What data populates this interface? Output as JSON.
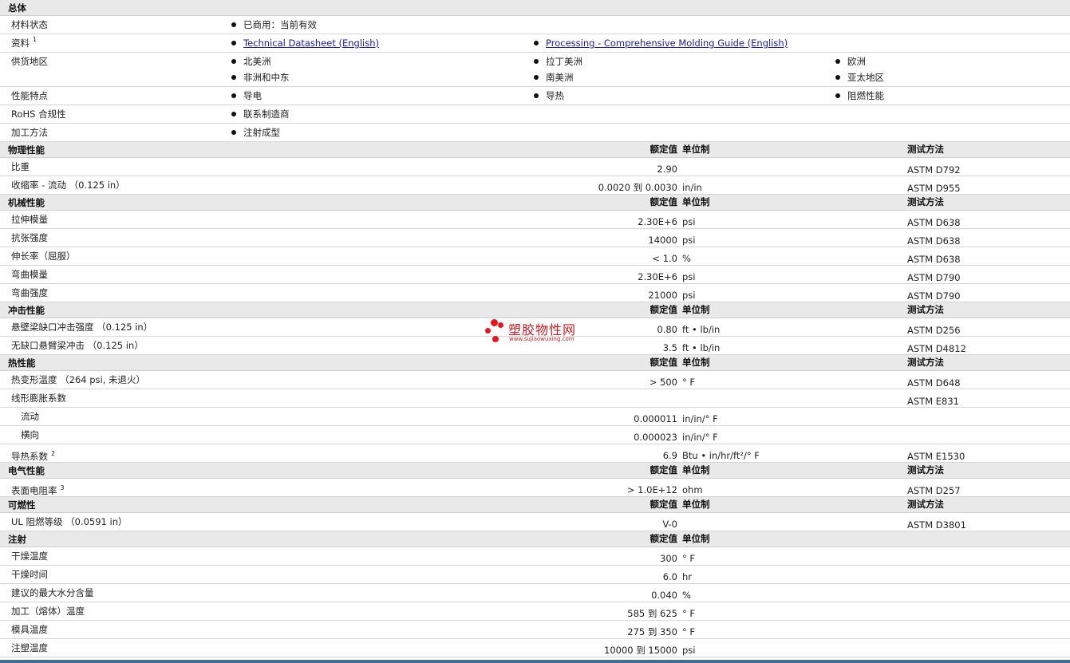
{
  "general": {
    "title": "总体",
    "rows": [
      {
        "label": "材料状态",
        "items": [
          "已商用：当前有效"
        ]
      },
      {
        "label": "资料",
        "sup": "1",
        "items": [
          "Technical Datasheet (English)",
          "Processing - Comprehensive Molding Guide (English)"
        ]
      },
      {
        "label": "供货地区",
        "items": [
          "北美洲",
          "拉丁美洲",
          "欧洲",
          "非洲和中东",
          "南美洲",
          "亚太地区"
        ]
      },
      {
        "label": "性能特点",
        "items": [
          "导电",
          "导热",
          "阻燃性能"
        ]
      },
      {
        "label": "RoHS 合规性",
        "items": [
          "联系制造商"
        ]
      },
      {
        "label": "加工方法",
        "items": [
          "注射成型"
        ]
      }
    ]
  },
  "col_headers": {
    "value": "额定值",
    "unit": "单位制",
    "test": "测试方法"
  },
  "sections": [
    {
      "title": "物理性能",
      "rows": [
        {
          "label": "比重",
          "value": "2.90",
          "unit": "",
          "test": "ASTM D792"
        },
        {
          "label": "收缩率 - 流动 （0.125 in）",
          "value": "0.0020 到  0.0030",
          "unit": "in/in",
          "test": "ASTM D955"
        }
      ]
    },
    {
      "title": "机械性能",
      "rows": [
        {
          "label": "拉伸模量",
          "value": "2.30E+6",
          "unit": "psi",
          "test": "ASTM D638"
        },
        {
          "label": "抗张强度",
          "value": "14000",
          "unit": "psi",
          "test": "ASTM D638"
        },
        {
          "label": "伸长率（屈服）",
          "value": "< 1.0",
          "unit": "%",
          "test": "ASTM D638"
        },
        {
          "label": "弯曲模量",
          "value": "2.30E+6",
          "unit": "psi",
          "test": "ASTM D790"
        },
        {
          "label": "弯曲强度",
          "value": "21000",
          "unit": "psi",
          "test": "ASTM D790"
        }
      ]
    },
    {
      "title": "冲击性能",
      "rows": [
        {
          "label": "悬壁梁缺口冲击强度 （0.125 in）",
          "value": "0.80",
          "unit": "ft • lb/in",
          "test": "ASTM D256"
        },
        {
          "label": "无缺口悬臂梁冲击 （0.125 in）",
          "value": "3.5",
          "unit": "ft • lb/in",
          "test": "ASTM D4812"
        }
      ]
    },
    {
      "title": "热性能",
      "rows": [
        {
          "label": "热变形温度 （264 psi, 未退火）",
          "value": "> 500",
          "unit": "°  F",
          "test": "ASTM D648"
        },
        {
          "label": "线形膨胀系数",
          "value": "",
          "unit": "",
          "test": "ASTM E831"
        },
        {
          "label": "流动",
          "sub": true,
          "value": "0.000011",
          "unit": "in/in/°  F",
          "test": ""
        },
        {
          "label": "横向",
          "sub": true,
          "value": "0.000023",
          "unit": "in/in/°  F",
          "test": ""
        },
        {
          "label": "导热系数",
          "sup": "2",
          "value": "6.9",
          "unit": "Btu • in/hr/ft²/°  F",
          "test": "ASTM E1530"
        }
      ]
    },
    {
      "title": "电气性能",
      "rows": [
        {
          "label": "表面电阻率",
          "sup": "3",
          "value": "> 1.0E+12",
          "unit": "ohm",
          "test": "ASTM D257"
        }
      ]
    },
    {
      "title": "可燃性",
      "rows": [
        {
          "label": "UL 阻燃等级 （0.0591 in）",
          "value": "V-0",
          "unit": "",
          "test": "ASTM D3801"
        }
      ]
    },
    {
      "title": "注射",
      "no_test": true,
      "rows": [
        {
          "label": "干燥温度",
          "value": "300",
          "unit": "°  F",
          "test": ""
        },
        {
          "label": "干燥时间",
          "value": "6.0",
          "unit": "hr",
          "test": ""
        },
        {
          "label": "建议的最大水分含量",
          "value": "0.040",
          "unit": "%",
          "test": ""
        },
        {
          "label": "加工（熔体）温度",
          "value": "585 到  625",
          "unit": "°  F",
          "test": ""
        },
        {
          "label": "模具温度",
          "value": "275 到  350",
          "unit": "°  F",
          "test": ""
        },
        {
          "label": "注塑温度",
          "value": "10000 到  15000",
          "unit": "psi",
          "test": ""
        }
      ]
    }
  ],
  "watermark": {
    "text": "塑胶物性网",
    "url": "www.sujiaowuxing.com"
  }
}
